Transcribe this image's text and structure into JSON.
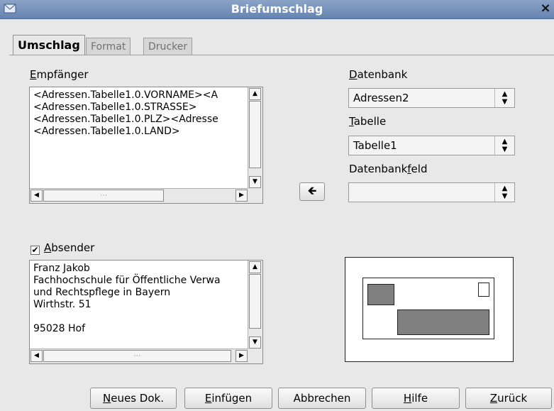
{
  "window": {
    "title": "Briefumschlag",
    "close_glyph": "×"
  },
  "tabs": [
    {
      "label": "Umschlag",
      "active": true
    },
    {
      "label": "Format",
      "active": false
    },
    {
      "label": "Drucker",
      "active": false
    }
  ],
  "recipient": {
    "label_key": "E",
    "label_rest": "mpfänger",
    "lines": [
      "<Adressen.Tabelle1.0.VORNAME><A",
      "<Adressen.Tabelle1.0.STRASSE>",
      "<Adressen.Tabelle1.0.PLZ><Adresse",
      "<Adressen.Tabelle1.0.LAND>"
    ],
    "scroll_grip": "⋯"
  },
  "database": {
    "label_key": "D",
    "label_rest": "atenbank",
    "value": "Adressen2",
    "table_label_key": "T",
    "table_label_rest": "abelle",
    "table_value": "Tabelle1",
    "field_label_pre": "Datenbank",
    "field_label_key": "f",
    "field_label_rest": "eld",
    "field_value": ""
  },
  "insert_arrow": "🡸",
  "sender": {
    "checked": true,
    "check_glyph": "✔",
    "label_key": "A",
    "label_rest": "bsender",
    "lines": [
      "Franz Jakob",
      "Fachhochschule für Öffentliche Verwa",
      "und Rechtspflege in Bayern",
      "Wirthstr. 51",
      "",
      "95028 Hof"
    ],
    "scroll_grip": "⋯"
  },
  "buttons": {
    "new_doc_key": "N",
    "new_doc_rest": "eues Dok.",
    "insert_key": "E",
    "insert_rest": "infügen",
    "cancel": "Abbrechen",
    "help_key": "H",
    "help_rest": "ilfe",
    "back_key": "Z",
    "back_rest": "urück"
  }
}
